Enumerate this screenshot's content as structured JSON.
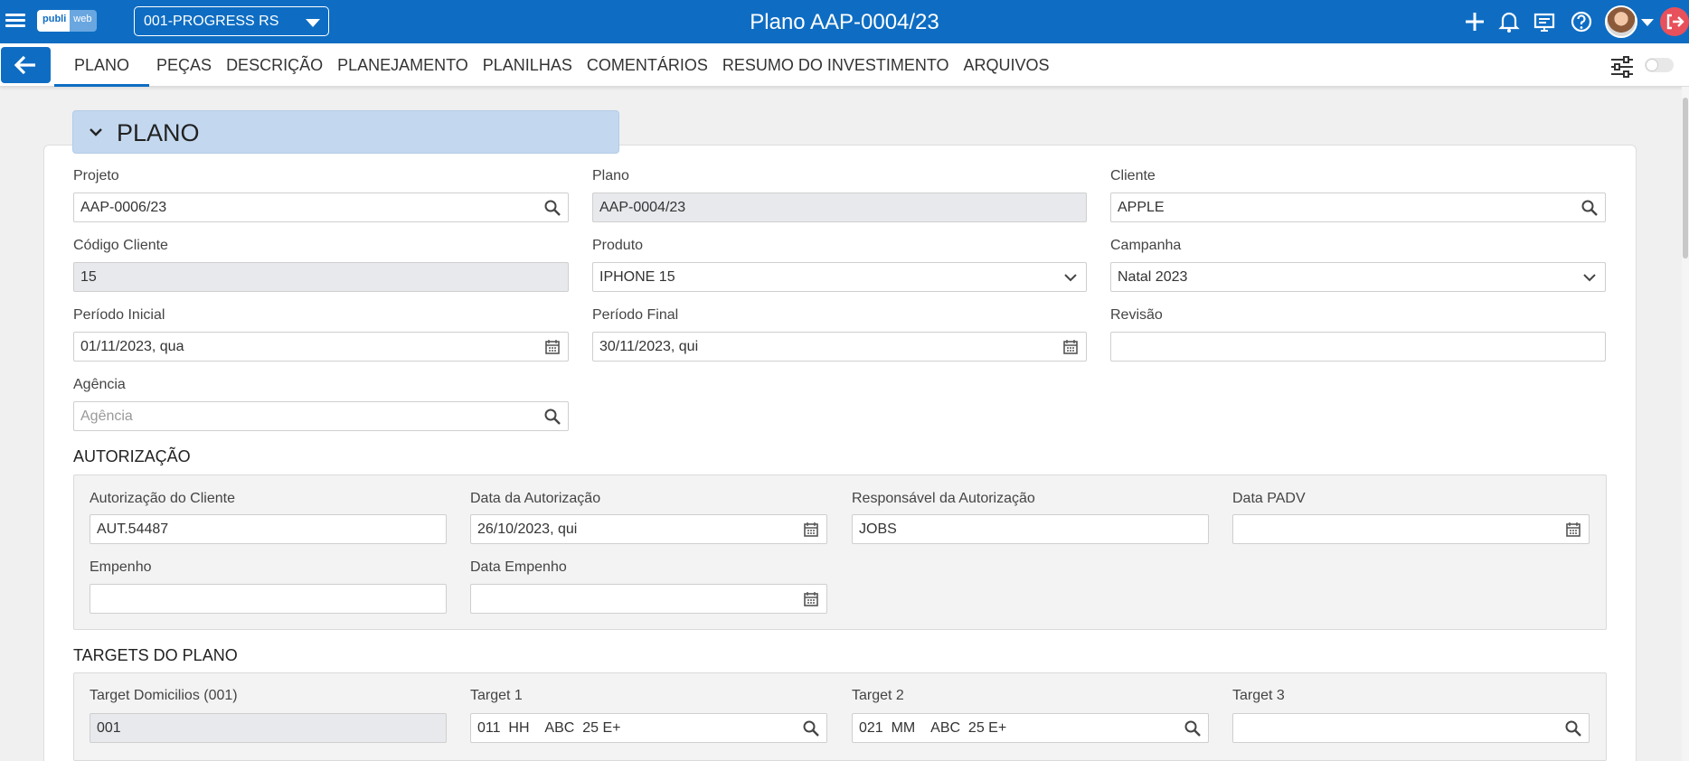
{
  "header": {
    "logo_a": "publi",
    "logo_b": "web",
    "company": "001-PROGRESS RS",
    "title": "Plano AAP-0004/23"
  },
  "tabs": [
    "PLANO",
    "PEÇAS",
    "DESCRIÇÃO",
    "PLANEJAMENTO",
    "PLANILHAS",
    "COMENTÁRIOS",
    "RESUMO DO INVESTIMENTO",
    "ARQUIVOS"
  ],
  "section": {
    "title": "PLANO"
  },
  "plano": {
    "projeto": {
      "label": "Projeto",
      "value": "AAP-0006/23"
    },
    "plano": {
      "label": "Plano",
      "value": "AAP-0004/23"
    },
    "cliente": {
      "label": "Cliente",
      "value": "APPLE"
    },
    "codigo_cliente": {
      "label": "Código Cliente",
      "value": "15"
    },
    "produto": {
      "label": "Produto",
      "value": "IPHONE 15"
    },
    "campanha": {
      "label": "Campanha",
      "value": "Natal 2023"
    },
    "periodo_inicial": {
      "label": "Período Inicial",
      "value": "01/11/2023, qua"
    },
    "periodo_final": {
      "label": "Período Final",
      "value": "30/11/2023, qui"
    },
    "revisao": {
      "label": "Revisão",
      "value": ""
    },
    "agencia": {
      "label": "Agência",
      "value": "",
      "placeholder": "Agência"
    }
  },
  "autorizacao": {
    "title": "AUTORIZAÇÃO",
    "autorizacao_cliente": {
      "label": "Autorização do Cliente",
      "value": "AUT.54487"
    },
    "data_autorizacao": {
      "label": "Data da Autorização",
      "value": "26/10/2023, qui"
    },
    "responsavel": {
      "label": "Responsável da Autorização",
      "value": "JOBS"
    },
    "data_padv": {
      "label": "Data PADV",
      "value": ""
    },
    "empenho": {
      "label": "Empenho",
      "value": ""
    },
    "data_empenho": {
      "label": "Data Empenho",
      "value": ""
    }
  },
  "targets": {
    "title": "TARGETS DO PLANO",
    "target_domicilios": {
      "label": "Target Domicilios (001)",
      "value": "001"
    },
    "target1": {
      "label": "Target 1",
      "value": "011  HH    ABC  25 E+"
    },
    "target2": {
      "label": "Target 2",
      "value": "021  MM    ABC  25 E+"
    },
    "target3": {
      "label": "Target 3",
      "value": ""
    }
  },
  "colors": {
    "brand": "#0e6dc3",
    "section_bg": "#c3d8ee"
  }
}
